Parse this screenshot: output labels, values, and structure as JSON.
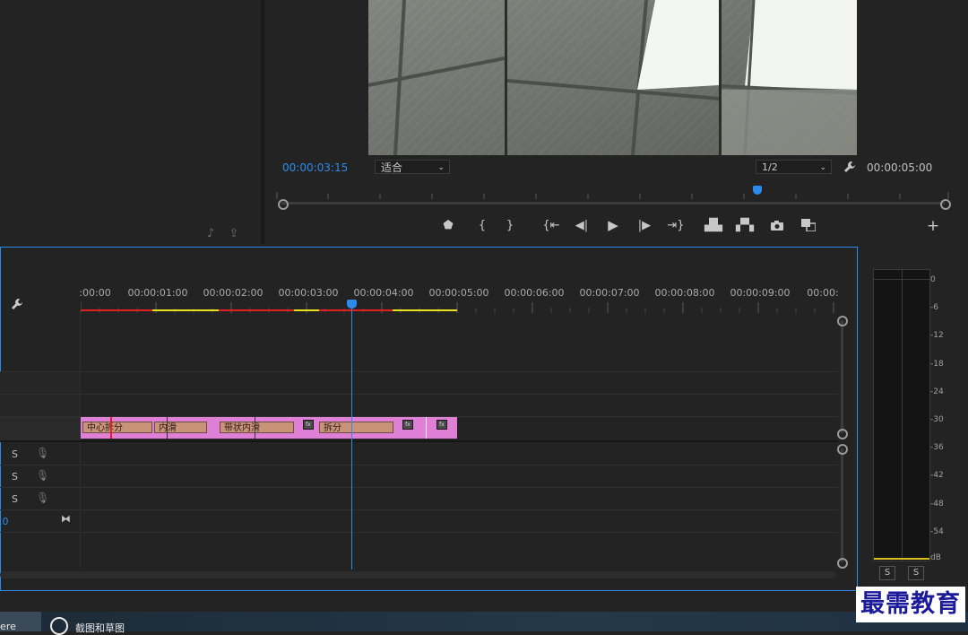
{
  "program_monitor": {
    "current_timecode": "00:00:03:15",
    "zoom_select": "适合",
    "resolution_select": "1/2",
    "duration_timecode": "00:00:05:00"
  },
  "timeline": {
    "ruler_labels": [
      ":00:00",
      "00:00:01:00",
      "00:00:02:00",
      "00:00:03:00",
      "00:00:04:00",
      "00:00:05:00",
      "00:00:06:00",
      "00:00:07:00",
      "00:00:08:00",
      "00:00:09:00",
      "00:00:"
    ],
    "clips": [
      {
        "label": "中心拆分"
      },
      {
        "label": "内滑"
      },
      {
        "label": "带状内滑"
      },
      {
        "label": "拆分"
      }
    ],
    "fx_badge": "fx",
    "audio_track_solo": [
      "S",
      "S",
      "S"
    ],
    "master_value": "0.0"
  },
  "audio_meter": {
    "db_scale": [
      "0",
      "-6",
      "-12",
      "-18",
      "-24",
      "-30",
      "-36",
      "-42",
      "-48",
      "-54",
      "dB"
    ],
    "solo_buttons": [
      "S",
      "S"
    ]
  },
  "taskbar": {
    "app_partial": "iere",
    "snip_tool": "截图和草图"
  },
  "watermark": "最需教育",
  "colors": {
    "accent_blue": "#2d8ceb",
    "clip_pink": "#e07fd6",
    "clip_tan": "#c9937a",
    "render_red": "#e02020",
    "render_yellow": "#e8e020"
  }
}
